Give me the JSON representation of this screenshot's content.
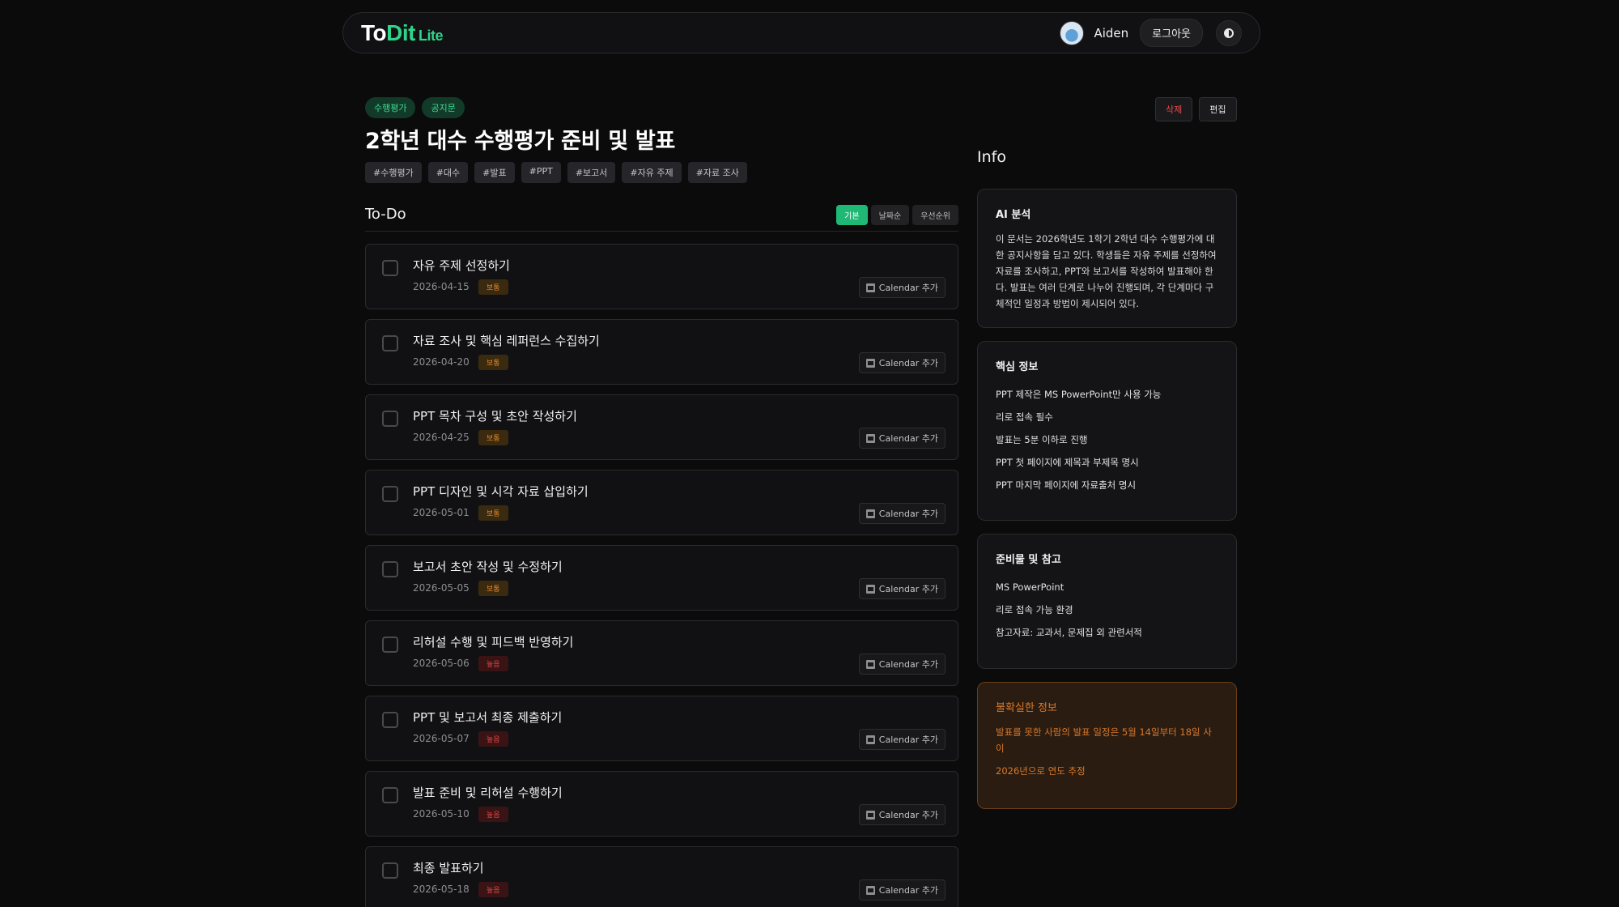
{
  "app": {
    "logo_to": "To",
    "logo_dit": "Dit",
    "logo_lite": "Lite",
    "brand_color": "#2fd48a"
  },
  "header": {
    "username": "Aiden",
    "logout_label": "로그아웃",
    "theme_icon": "contrast-icon"
  },
  "doc": {
    "categories": [
      "수행평가",
      "공지문"
    ],
    "title": "2학년 대수 수행평가 준비 및 발표",
    "hashtags": [
      "#수행평가",
      "#대수",
      "#발표",
      "#PPT",
      "#보고서",
      "#자유 주제",
      "#자료 조사"
    ],
    "delete_label": "삭제",
    "edit_label": "편집"
  },
  "todo": {
    "heading": "To-Do",
    "sort_options": [
      "기본",
      "날짜순",
      "우선순위"
    ],
    "active_sort": "기본",
    "calendar_label": "Calendar 추가",
    "items": [
      {
        "title": "자유 주제 선정하기",
        "date": "2026-04-15",
        "priority": "보통",
        "level": "mid"
      },
      {
        "title": "자료 조사 및 핵심 레퍼런스 수집하기",
        "date": "2026-04-20",
        "priority": "보통",
        "level": "mid"
      },
      {
        "title": "PPT 목차 구성 및 초안 작성하기",
        "date": "2026-04-25",
        "priority": "보통",
        "level": "mid"
      },
      {
        "title": "PPT 디자인 및 시각 자료 삽입하기",
        "date": "2026-05-01",
        "priority": "보통",
        "level": "mid"
      },
      {
        "title": "보고서 초안 작성 및 수정하기",
        "date": "2026-05-05",
        "priority": "보통",
        "level": "mid"
      },
      {
        "title": "리허설 수행 및 피드백 반영하기",
        "date": "2026-05-06",
        "priority": "높음",
        "level": "high"
      },
      {
        "title": "PPT 및 보고서 최종 제출하기",
        "date": "2026-05-07",
        "priority": "높음",
        "level": "high"
      },
      {
        "title": "발표 준비 및 리허설 수행하기",
        "date": "2026-05-10",
        "priority": "높음",
        "level": "high"
      },
      {
        "title": "최종 발표하기",
        "date": "2026-05-18",
        "priority": "높음",
        "level": "high"
      }
    ]
  },
  "info": {
    "heading": "Info",
    "ai": {
      "heading": "AI 분석",
      "text": "이 문서는 2026학년도 1학기 2학년 대수 수행평가에 대한 공지사항을 담고 있다. 학생들은 자유 주제를 선정하여 자료를 조사하고, PPT와 보고서를 작성하여 발표해야 한다. 발표는 여러 단계로 나누어 진행되며, 각 단계마다 구체적인 일정과 방법이 제시되어 있다."
    },
    "key": {
      "heading": "핵심 정보",
      "items": [
        "PPT 제작은 MS PowerPoint만 사용 가능",
        "리로 접속 필수",
        "발표는 5분 이하로 진행",
        "PPT 첫 페이지에 제목과 부제목 명시",
        "PPT 마지막 페이지에 자료출처 명시"
      ]
    },
    "prep": {
      "heading": "준비물 및 참고",
      "items": [
        "MS PowerPoint",
        "리로 접속 가능 환경",
        "참고자료: 교과서, 문제집 외 관련서적"
      ]
    },
    "uncertain": {
      "heading": "불확실한 정보",
      "items": [
        "발표를 못한 사람의 발표 일정은 5월 14일부터 18일 사이",
        "2026년으로 연도 추정"
      ]
    }
  }
}
